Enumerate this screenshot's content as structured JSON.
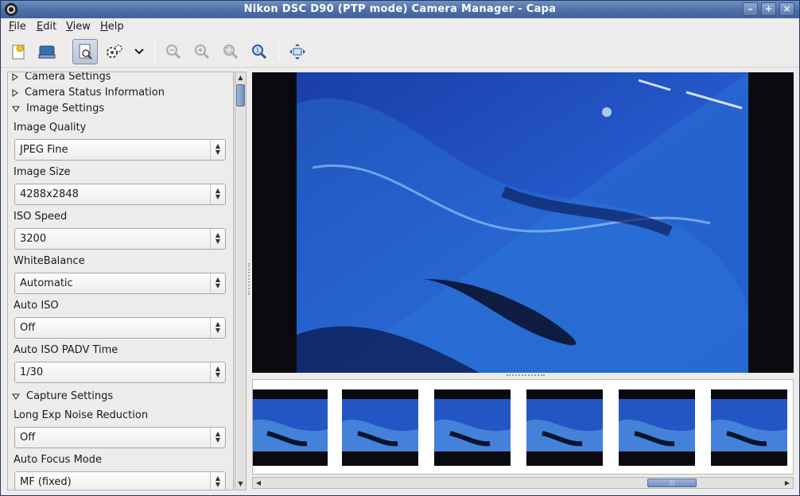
{
  "window": {
    "title": "Nikon DSC D90 (PTP mode) Camera Manager - Capa"
  },
  "menu": [
    {
      "label": "File",
      "mnemonic": "F",
      "rest": "ile"
    },
    {
      "label": "Edit",
      "mnemonic": "E",
      "rest": "dit"
    },
    {
      "label": "View",
      "mnemonic": "V",
      "rest": "iew"
    },
    {
      "label": "Help",
      "mnemonic": "H",
      "rest": "elp"
    }
  ],
  "toolbar": {
    "icons": [
      "new-session-icon",
      "open-icon",
      "camera-settings-icon",
      "gear-icon",
      "chevron-down-icon",
      "zoom-out-icon",
      "zoom-in-icon",
      "zoom-fit-icon",
      "zoom-100-icon",
      "fullscreen-icon"
    ]
  },
  "settings": {
    "sections": [
      {
        "label": "Camera Settings",
        "expanded": false
      },
      {
        "label": "Camera Status Information",
        "expanded": false
      },
      {
        "label": "Image Settings",
        "expanded": true
      },
      {
        "label": "Capture Settings",
        "expanded": true
      }
    ],
    "image_settings": [
      {
        "label": "Image Quality",
        "value": "JPEG Fine"
      },
      {
        "label": "Image Size",
        "value": "4288x2848"
      },
      {
        "label": "ISO Speed",
        "value": "3200"
      },
      {
        "label": "WhiteBalance",
        "value": "Automatic"
      },
      {
        "label": "Auto ISO",
        "value": "Off"
      },
      {
        "label": "Auto ISO PADV Time",
        "value": "1/30"
      }
    ],
    "capture_settings": [
      {
        "label": "Long Exp Noise Reduction",
        "value": "Off"
      },
      {
        "label": "Auto Focus Mode",
        "value": "MF (fixed)"
      }
    ]
  },
  "thumbnails": {
    "count": 6
  },
  "colors": {
    "titlebar": "#4d6fa5",
    "preview_bg": "#0a0b10",
    "water": "#1e5fd0"
  }
}
